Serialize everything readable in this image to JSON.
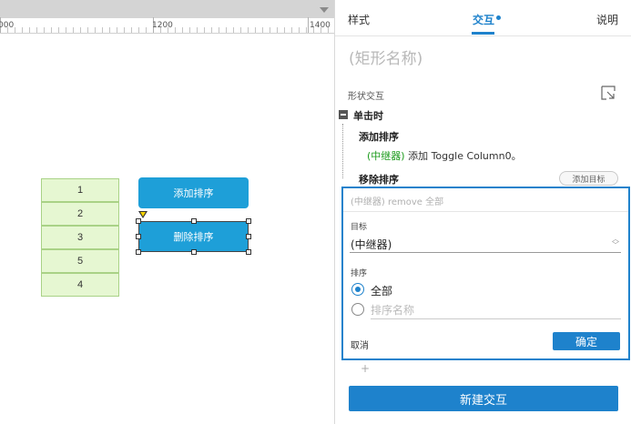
{
  "ruler": {
    "labels": [
      "000",
      "1200",
      "1400"
    ]
  },
  "canvas": {
    "repeater_cells": [
      "1",
      "2",
      "3",
      "5",
      "4"
    ],
    "add_sort_button": "添加排序",
    "remove_sort_button": "删除排序"
  },
  "panel": {
    "tabs": {
      "style": "样式",
      "interaction": "交互",
      "notes": "说明"
    },
    "shape_name_placeholder": "(矩形名称)",
    "section_title": "形状交互",
    "event": "单击时",
    "case1": {
      "title": "添加排序",
      "target": "(中继器)",
      "action": " 添加 Toggle Column0。"
    },
    "case2": {
      "title": "移除排序"
    },
    "add_target_button": "添加目标",
    "editor": {
      "summary": "(中继器) remove 全部",
      "target_label": "目标",
      "target_value": "(中继器)",
      "sort_label": "排序",
      "radio_all": "全部",
      "sort_name_placeholder": "排序名称",
      "cancel": "取消",
      "confirm": "确定"
    },
    "plus": "+",
    "new_interaction": "新建交互"
  },
  "colors": {
    "accent": "#1e82cc",
    "canvas_button": "#1e9fd8",
    "cell_fill": "#e6f7d2",
    "case_target": "#1a9a1a"
  },
  "icons": [
    "chevron-down-icon",
    "expand-corner-icon",
    "collapse-minus-icon",
    "radio-selected-icon",
    "radio-unselected-icon",
    "spinner-icon",
    "plus-icon"
  ]
}
